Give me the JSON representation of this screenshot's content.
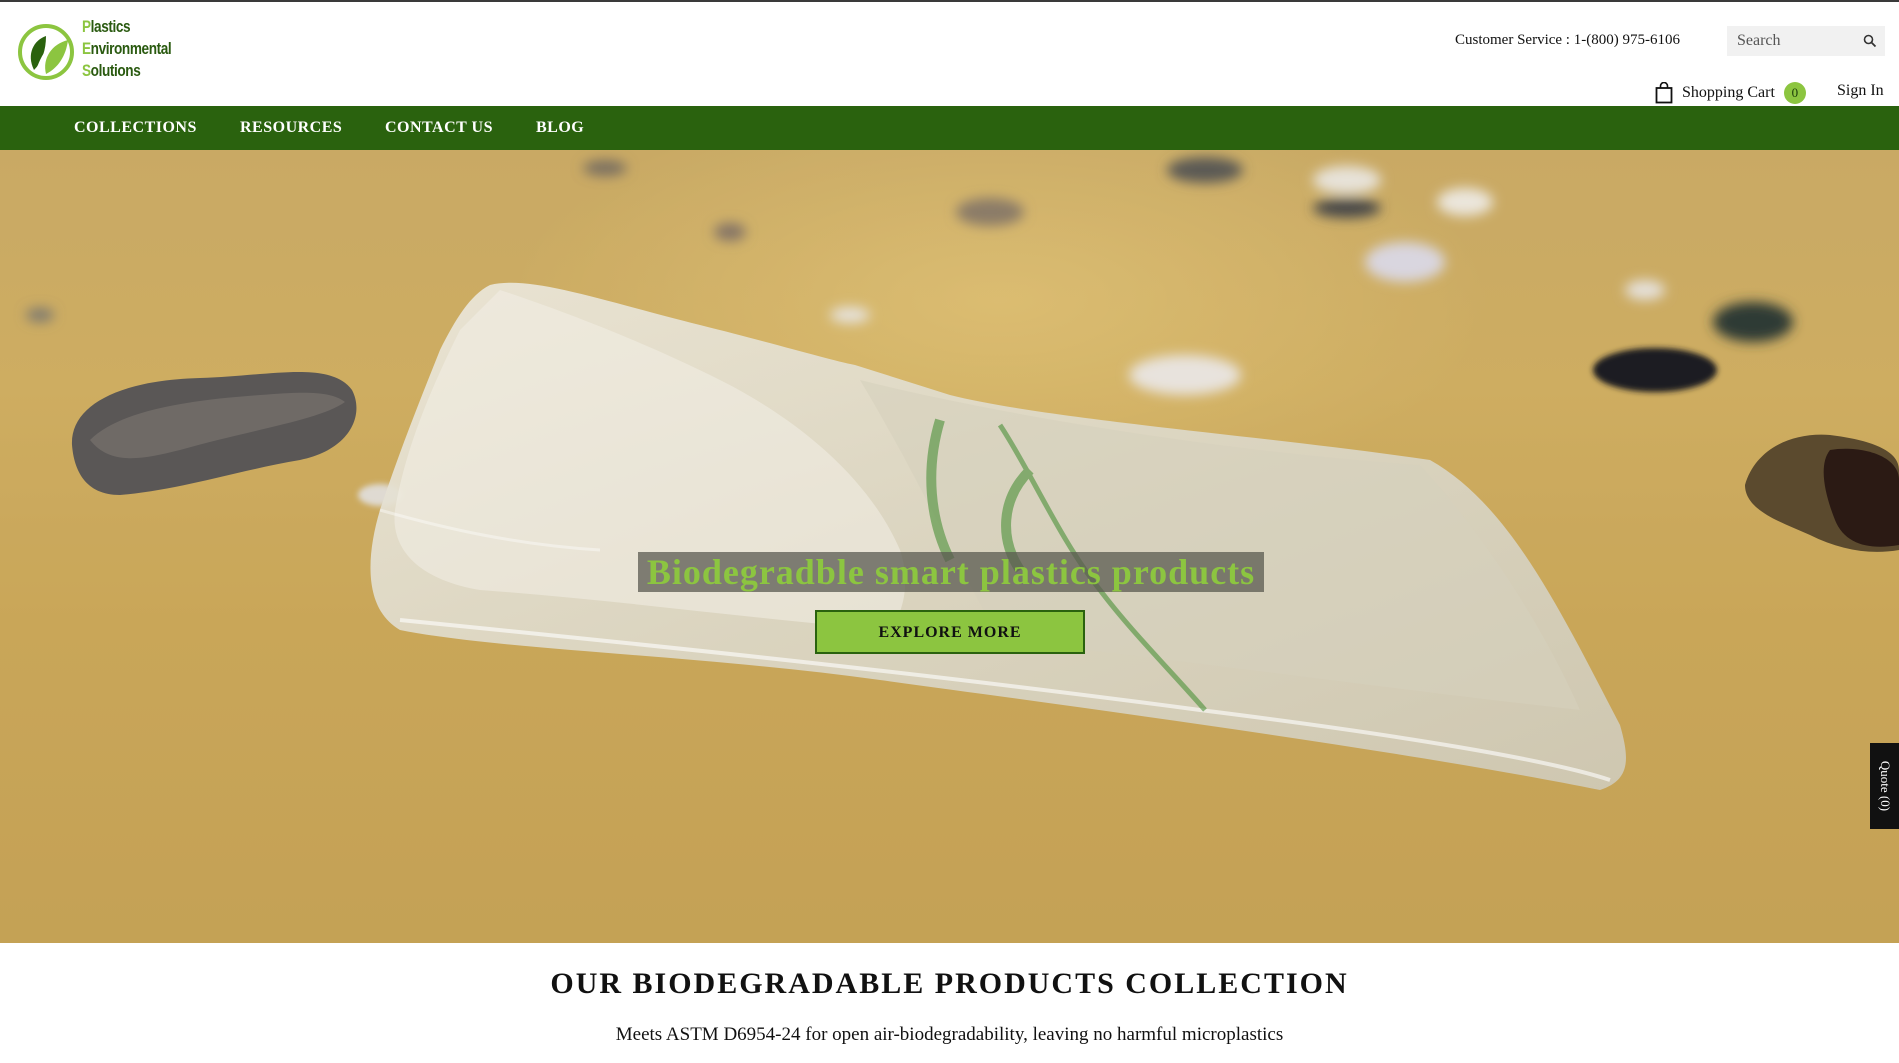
{
  "brand": {
    "logo_lines": [
      "Plastics",
      "Environmental",
      "Solutions"
    ],
    "colors": {
      "dark_green": "#2a620e",
      "light_green": "#8cc540"
    }
  },
  "header": {
    "customer_service": "Customer Service : 1-(800) 975-6106",
    "search_placeholder": "Search",
    "cart_label": "Shopping Cart",
    "cart_count": "0",
    "sign_in": "Sign In"
  },
  "nav": {
    "items": [
      "COLLECTIONS",
      "RESOURCES",
      "CONTACT US",
      "BLOG"
    ]
  },
  "hero": {
    "headline": "Biodegradble smart plastics products",
    "button": "EXPLORE MORE"
  },
  "quote_tab": "Quote (0)",
  "collection": {
    "title": "OUR BIODEGRADABLE PRODUCTS COLLECTION",
    "subtitle": "Meets ASTM D6954-24 for open air-biodegradability, leaving no harmful microplastics"
  },
  "icons": [
    "leaf-logo-icon",
    "search-icon",
    "shopping-bag-icon"
  ]
}
